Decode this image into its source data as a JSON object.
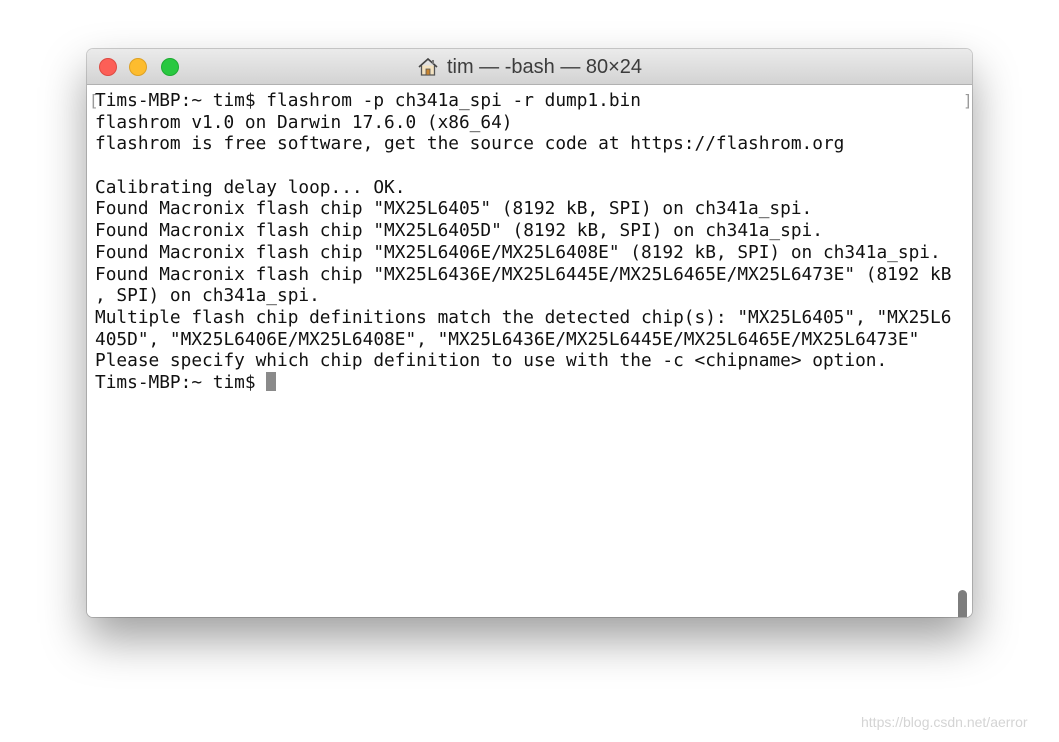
{
  "window": {
    "title": "tim — -bash — 80×24",
    "title_icon": "home-icon"
  },
  "terminal": {
    "lines": [
      "Tims-MBP:~ tim$ flashrom -p ch341a_spi -r dump1.bin",
      "flashrom v1.0 on Darwin 17.6.0 (x86_64)",
      "flashrom is free software, get the source code at https://flashrom.org",
      "",
      "Calibrating delay loop... OK.",
      "Found Macronix flash chip \"MX25L6405\" (8192 kB, SPI) on ch341a_spi.",
      "Found Macronix flash chip \"MX25L6405D\" (8192 kB, SPI) on ch341a_spi.",
      "Found Macronix flash chip \"MX25L6406E/MX25L6408E\" (8192 kB, SPI) on ch341a_spi.",
      "Found Macronix flash chip \"MX25L6436E/MX25L6445E/MX25L6465E/MX25L6473E\" (8192 kB",
      ", SPI) on ch341a_spi.",
      "Multiple flash chip definitions match the detected chip(s): \"MX25L6405\", \"MX25L6",
      "405D\", \"MX25L6406E/MX25L6408E\", \"MX25L6436E/MX25L6445E/MX25L6465E/MX25L6473E\"",
      "Please specify which chip definition to use with the -c <chipname> option."
    ],
    "prompt": "Tims-MBP:~ tim$ ",
    "mark_left": "[",
    "mark_right": "]"
  },
  "watermark": "https://blog.csdn.net/aerror",
  "colors": {
    "close": "#fc5f57",
    "minimize": "#fdbc2e",
    "maximize": "#29c840",
    "text": "#111111",
    "background": "#ffffff"
  }
}
